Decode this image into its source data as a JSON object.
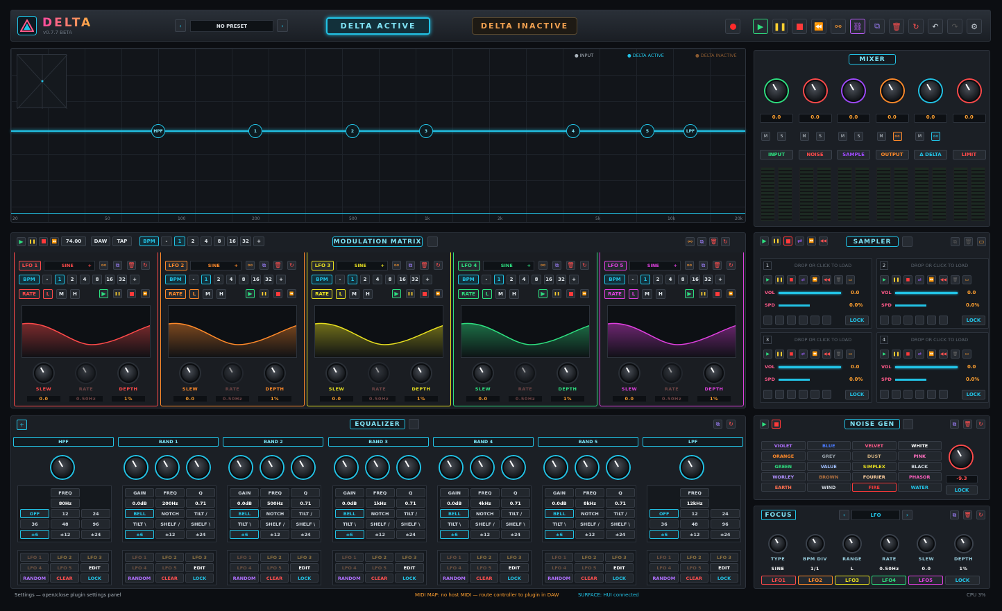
{
  "header": {
    "app_name": "DELTA",
    "version": "v0.7.7 BETA",
    "preset": "NO PRESET",
    "delta_active": "DELTA ACTIVE",
    "delta_inactive": "DELTA INACTIVE"
  },
  "graph": {
    "legend": [
      "INPUT",
      "DELTA ACTIVE",
      "DELTA INACTIVE"
    ],
    "nodes": [
      "HPF",
      "1",
      "2",
      "3",
      "4",
      "5",
      "LPF"
    ],
    "freq_ticks": [
      "20",
      "50",
      "100",
      "200",
      "500",
      "1k",
      "2k",
      "5k",
      "10k",
      "20k"
    ]
  },
  "mixer": {
    "title": "MIXER",
    "values": [
      "0.0",
      "0.0",
      "0.0",
      "0.0",
      "0.0",
      "0.0"
    ],
    "channels": [
      "INPUT",
      "NOISE",
      "SAMPLE",
      "OUTPUT",
      "Δ DELTA",
      "LIMIT"
    ],
    "knob_colors": [
      "#2ee080",
      "#ff4a4a",
      "#a04aff",
      "#ff8a2a",
      "#22c3e6",
      "#ff4a4a"
    ]
  },
  "transport": {
    "bpm": "74.00",
    "daw": "DAW",
    "tap": "TAP",
    "bpm_label": "BPM",
    "divs": [
      "-",
      "1",
      "2",
      "4",
      "8",
      "16",
      "32",
      "+"
    ]
  },
  "modmatrix": {
    "title": "MODULATION MATRIX"
  },
  "lfos": [
    {
      "name": "LFO 1",
      "wave": "SINE",
      "color": "#ff4a4a",
      "rate_label": "RATE",
      "sel": "L",
      "slew": "0.0",
      "rate": "0.50Hz",
      "depth": "1%"
    },
    {
      "name": "LFO 2",
      "wave": "SINE",
      "color": "#ff8a2a",
      "rate_label": "RATE",
      "sel": "L",
      "slew": "0.0",
      "rate": "0.50Hz",
      "depth": "1%"
    },
    {
      "name": "LFO 3",
      "wave": "SINE",
      "color": "#e8e020",
      "rate_label": "RATE",
      "sel": "L",
      "slew": "0.0",
      "rate": "0.50Hz",
      "depth": "1%"
    },
    {
      "name": "LFO 4",
      "wave": "SINE",
      "color": "#2ee080",
      "rate_label": "RATE",
      "sel": "L",
      "slew": "0.0",
      "rate": "0.50Hz",
      "depth": "1%"
    },
    {
      "name": "LFO 5",
      "wave": "SINE",
      "color": "#e040e0",
      "rate_label": "RATE",
      "sel": "L",
      "slew": "0.0",
      "rate": "0.50Hz",
      "depth": "1%"
    }
  ],
  "lfo_labels": {
    "slew": "SLEW",
    "rate": "RATE",
    "depth": "DEPTH",
    "bpm": "BPM",
    "m": "M",
    "h": "H",
    "divs": [
      "-",
      "1",
      "2",
      "4",
      "8",
      "16",
      "32",
      "+"
    ]
  },
  "sampler": {
    "title": "SAMPLER",
    "drop": "DROP OR CLICK TO LOAD",
    "slots": [
      {
        "num": "1",
        "vol": "0.0",
        "spd": "0.0%"
      },
      {
        "num": "2",
        "vol": "0.0",
        "spd": "0.0%"
      },
      {
        "num": "3",
        "vol": "0.0",
        "spd": "0.0%"
      },
      {
        "num": "4",
        "vol": "0.0",
        "spd": "0.0%"
      }
    ],
    "vol_label": "VOL",
    "spd_label": "SPD",
    "lock": "LOCK"
  },
  "eq": {
    "title": "EQUALIZER",
    "bands": [
      "HPF",
      "BAND 1",
      "BAND 2",
      "BAND 3",
      "BAND 4",
      "BAND 5",
      "LPF"
    ],
    "hpf": {
      "freq": "80Hz"
    },
    "lpf": {
      "freq": "12kHz"
    },
    "peak": [
      {
        "freq": "200Hz"
      },
      {
        "freq": "500Hz"
      },
      {
        "freq": "1kHz"
      },
      {
        "freq": "4kHz"
      },
      {
        "freq": "8kHz"
      }
    ],
    "labels": {
      "freq": "FREQ",
      "gain": "GAIN",
      "q": "Q",
      "gain_v": "0.0dB",
      "q_v": "0.71",
      "bell": "BELL",
      "notch": "NOTCH",
      "tilt1": "TILT /",
      "tilt2": "TILT \\",
      "shelf1": "SHELF /",
      "shelf2": "SHELF \\",
      "off": "OFF",
      "s12": "12",
      "s24": "24",
      "s36": "36",
      "s48": "48",
      "s96": "96",
      "pm6": "±6",
      "pm12": "±12",
      "pm24": "±24",
      "lfo1": "LFO 1",
      "lfo2": "LFO 2",
      "lfo3": "LFO 3",
      "lfo4": "LFO 4",
      "lfo5": "LFO 5",
      "edit": "EDIT",
      "random": "RANDOM",
      "clear": "CLEAR",
      "lock": "LOCK"
    }
  },
  "noise": {
    "title": "NOISE GEN",
    "types": [
      "VIOLET",
      "BLUE",
      "VELVET",
      "WHITE",
      "ORANGE",
      "GREY",
      "DUST",
      "PINK",
      "GREEN",
      "VALUE",
      "SIMPLEX",
      "BLACK",
      "WORLEY",
      "BROWN",
      "FOURIER",
      "PHASOR",
      "EARTH",
      "WIND",
      "FIRE",
      "WATER"
    ],
    "level": "-9.3",
    "lock": "LOCK"
  },
  "focus": {
    "title": "FOCUS",
    "lfo": "LFO",
    "params": [
      {
        "label": "TYPE",
        "value": "SINE"
      },
      {
        "label": "BPM DIV",
        "value": "1/1"
      },
      {
        "label": "RANGE",
        "value": "L"
      },
      {
        "label": "RATE",
        "value": "0.50Hz"
      },
      {
        "label": "SLEW",
        "value": "0.0"
      },
      {
        "label": "DEPTH",
        "value": "1%"
      }
    ],
    "lfos": [
      "LFO1",
      "LFO2",
      "LFO3",
      "LFO4",
      "LFO5"
    ],
    "lock": "LOCK"
  },
  "status": {
    "left": "Settings — open/close plugin settings panel",
    "midi": "MIDI MAP: no host MIDI — route controller to plugin in DAW",
    "surface": "SURFACE: HUI connected",
    "cpu": "CPU 3%"
  }
}
